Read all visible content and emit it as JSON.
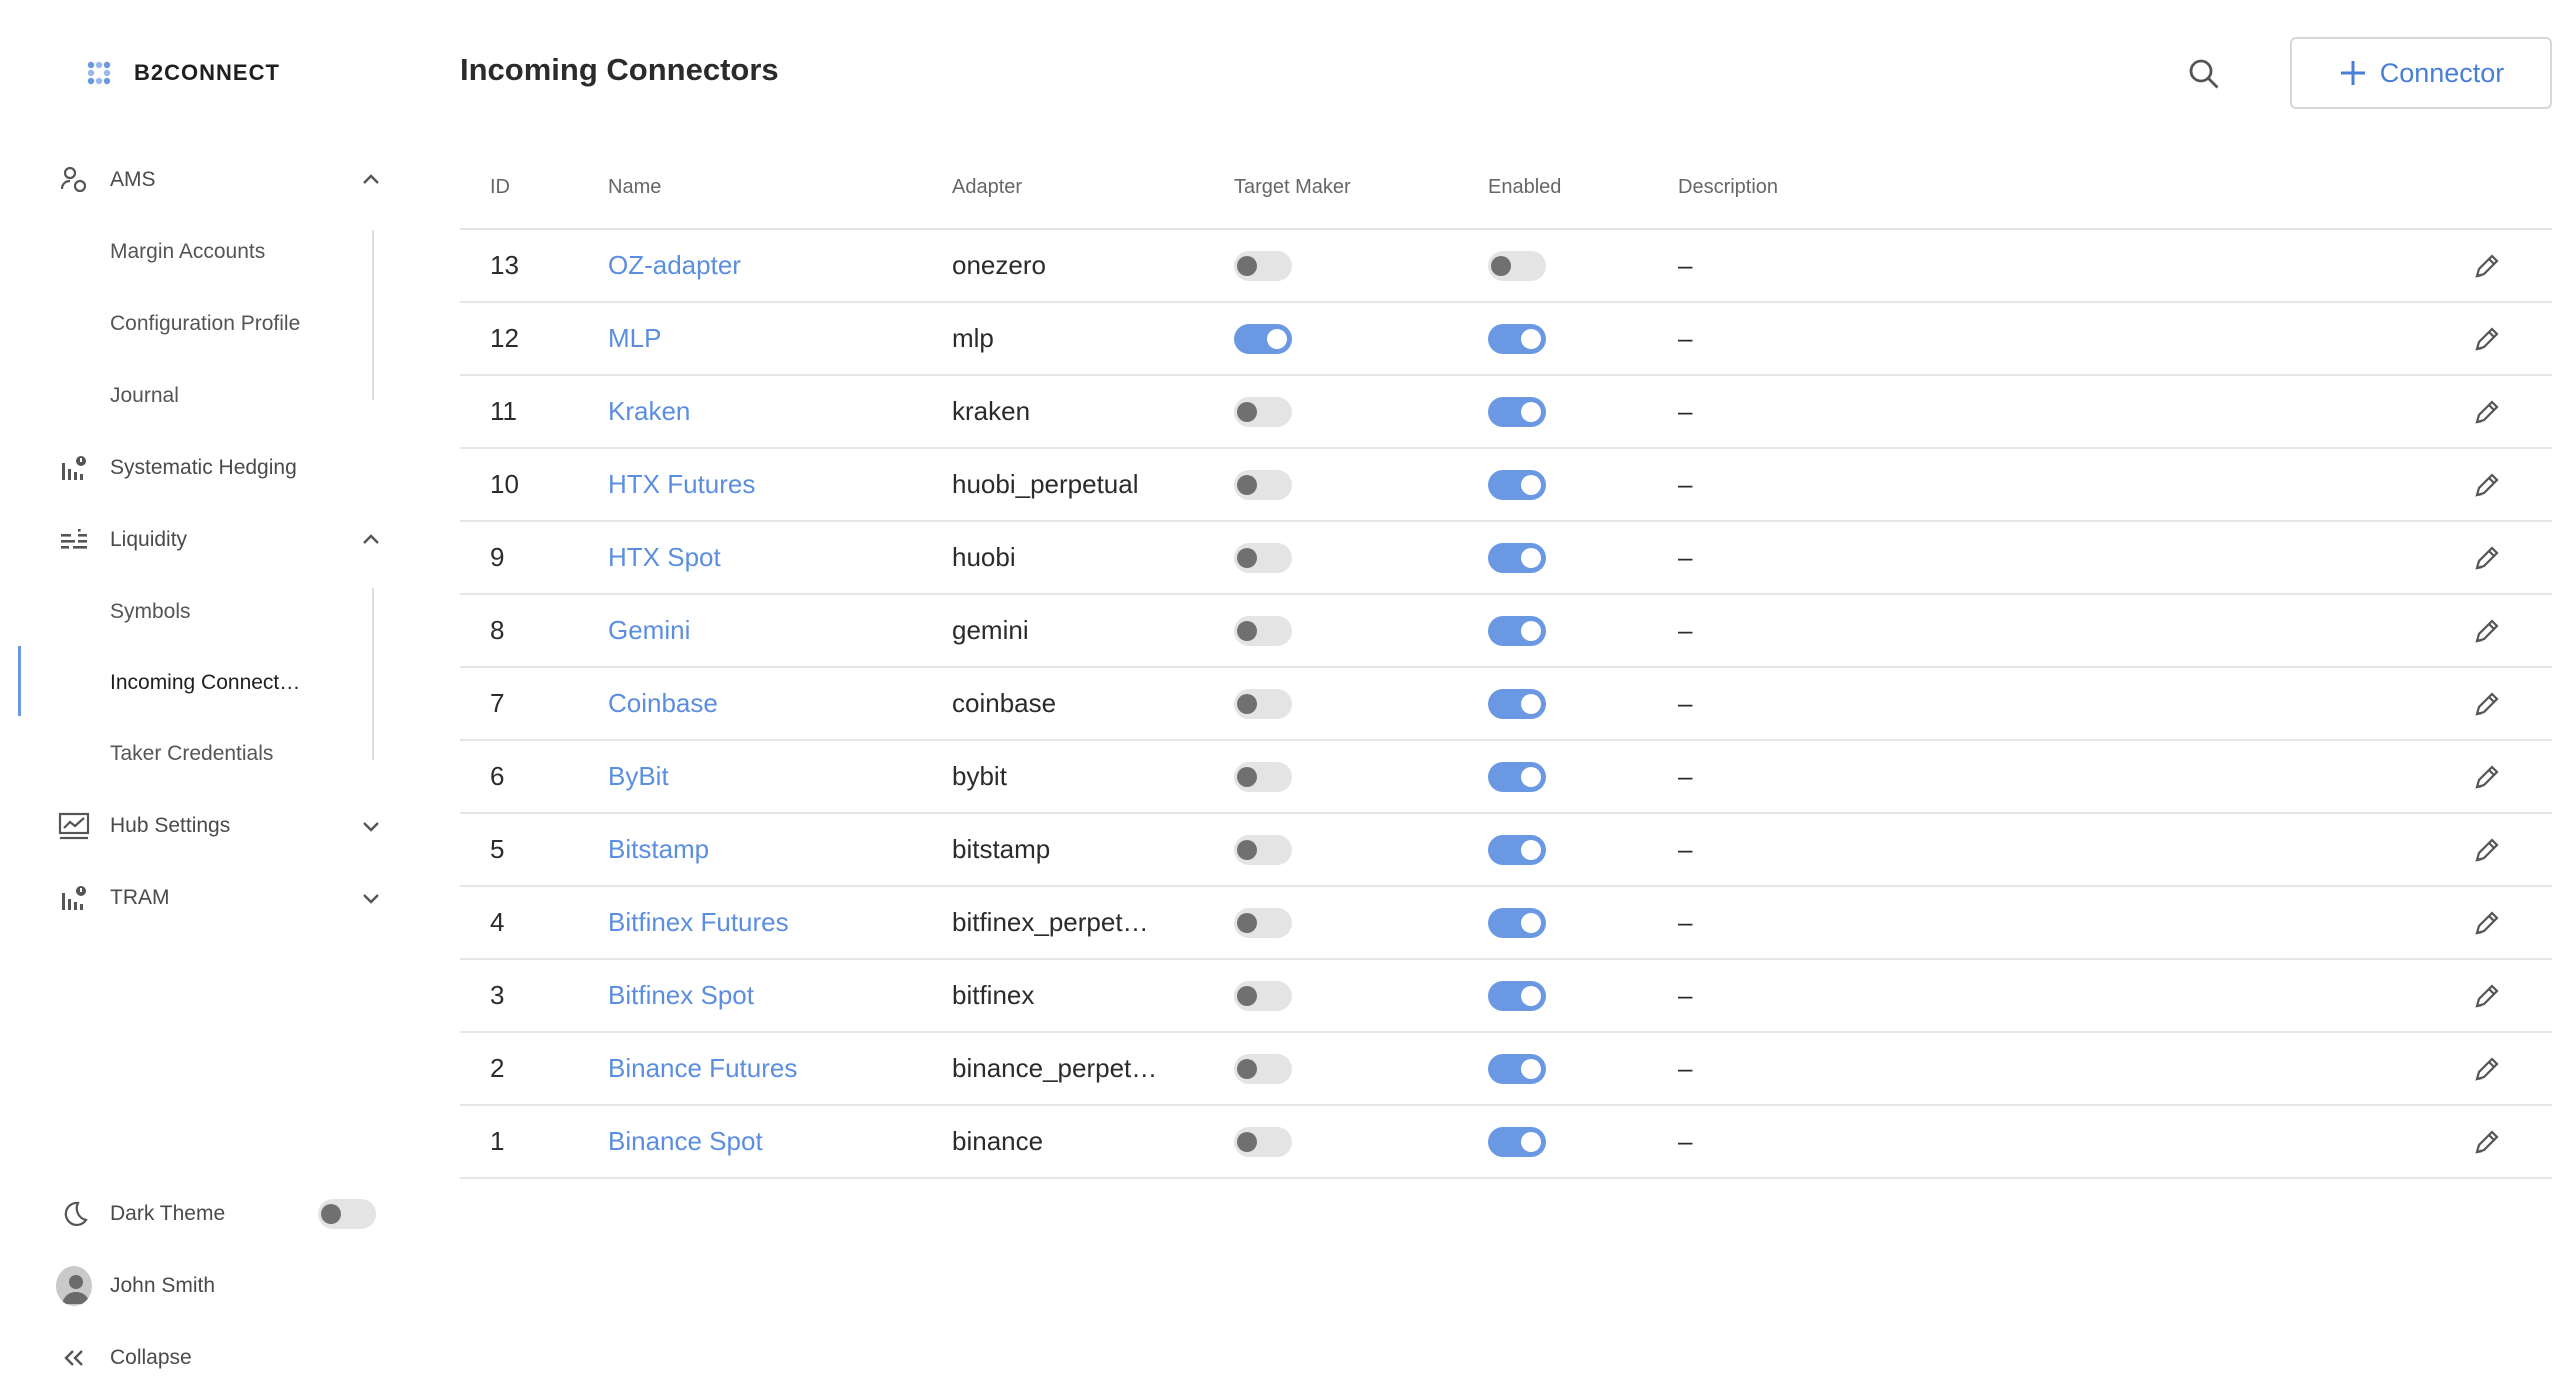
{
  "app": {
    "brand": "B2CONNECT",
    "accent_color": "#6b98e3",
    "link_color": "#5b8ee0"
  },
  "sidebar": {
    "groups": [
      {
        "label": "AMS",
        "icon": "user-group-icon",
        "expanded": true,
        "items": [
          "Margin Accounts",
          "Configuration Profile",
          "Journal"
        ]
      },
      {
        "label": "Systematic Hedging",
        "icon": "chart-bars-icon"
      },
      {
        "label": "Liquidity",
        "icon": "liquidity-icon",
        "expanded": true,
        "items": [
          "Symbols",
          "Incoming Connect…",
          "Taker Credentials"
        ]
      },
      {
        "label": "Hub Settings",
        "icon": "monitor-chart-icon",
        "expanded": false
      },
      {
        "label": "TRAM",
        "icon": "chart-bars-icon",
        "expanded": false
      }
    ],
    "active_item": "Incoming Connect…",
    "dark_theme_label": "Dark Theme",
    "dark_theme_on": false,
    "user_name": "John Smith",
    "collapse_label": "Collapse"
  },
  "header": {
    "title": "Incoming Connectors",
    "search_icon": "search-icon",
    "add_label": "Connector"
  },
  "table": {
    "columns": [
      "ID",
      "Name",
      "Adapter",
      "Target Maker",
      "Enabled",
      "Description"
    ],
    "rows": [
      {
        "id": "13",
        "name": "OZ-adapter",
        "adapter": "onezero",
        "target_maker": false,
        "enabled": false,
        "description": "–"
      },
      {
        "id": "12",
        "name": "MLP",
        "adapter": "mlp",
        "target_maker": true,
        "enabled": true,
        "description": "–"
      },
      {
        "id": "11",
        "name": "Kraken",
        "adapter": "kraken",
        "target_maker": false,
        "enabled": true,
        "description": "–"
      },
      {
        "id": "10",
        "name": "HTX Futures",
        "adapter": "huobi_perpetual",
        "target_maker": false,
        "enabled": true,
        "description": "–"
      },
      {
        "id": "9",
        "name": "HTX Spot",
        "adapter": "huobi",
        "target_maker": false,
        "enabled": true,
        "description": "–"
      },
      {
        "id": "8",
        "name": "Gemini",
        "adapter": "gemini",
        "target_maker": false,
        "enabled": true,
        "description": "–"
      },
      {
        "id": "7",
        "name": "Coinbase",
        "adapter": "coinbase",
        "target_maker": false,
        "enabled": true,
        "description": "–"
      },
      {
        "id": "6",
        "name": "ByBit",
        "adapter": "bybit",
        "target_maker": false,
        "enabled": true,
        "description": "–"
      },
      {
        "id": "5",
        "name": "Bitstamp",
        "adapter": "bitstamp",
        "target_maker": false,
        "enabled": true,
        "description": "–"
      },
      {
        "id": "4",
        "name": "Bitfinex Futures",
        "adapter": "bitfinex_perpet…",
        "target_maker": false,
        "enabled": true,
        "description": "–"
      },
      {
        "id": "3",
        "name": "Bitfinex Spot",
        "adapter": "bitfinex",
        "target_maker": false,
        "enabled": true,
        "description": "–"
      },
      {
        "id": "2",
        "name": "Binance Futures",
        "adapter": "binance_perpet…",
        "target_maker": false,
        "enabled": true,
        "description": "–"
      },
      {
        "id": "1",
        "name": "Binance Spot",
        "adapter": "binance",
        "target_maker": false,
        "enabled": true,
        "description": "–"
      }
    ]
  }
}
